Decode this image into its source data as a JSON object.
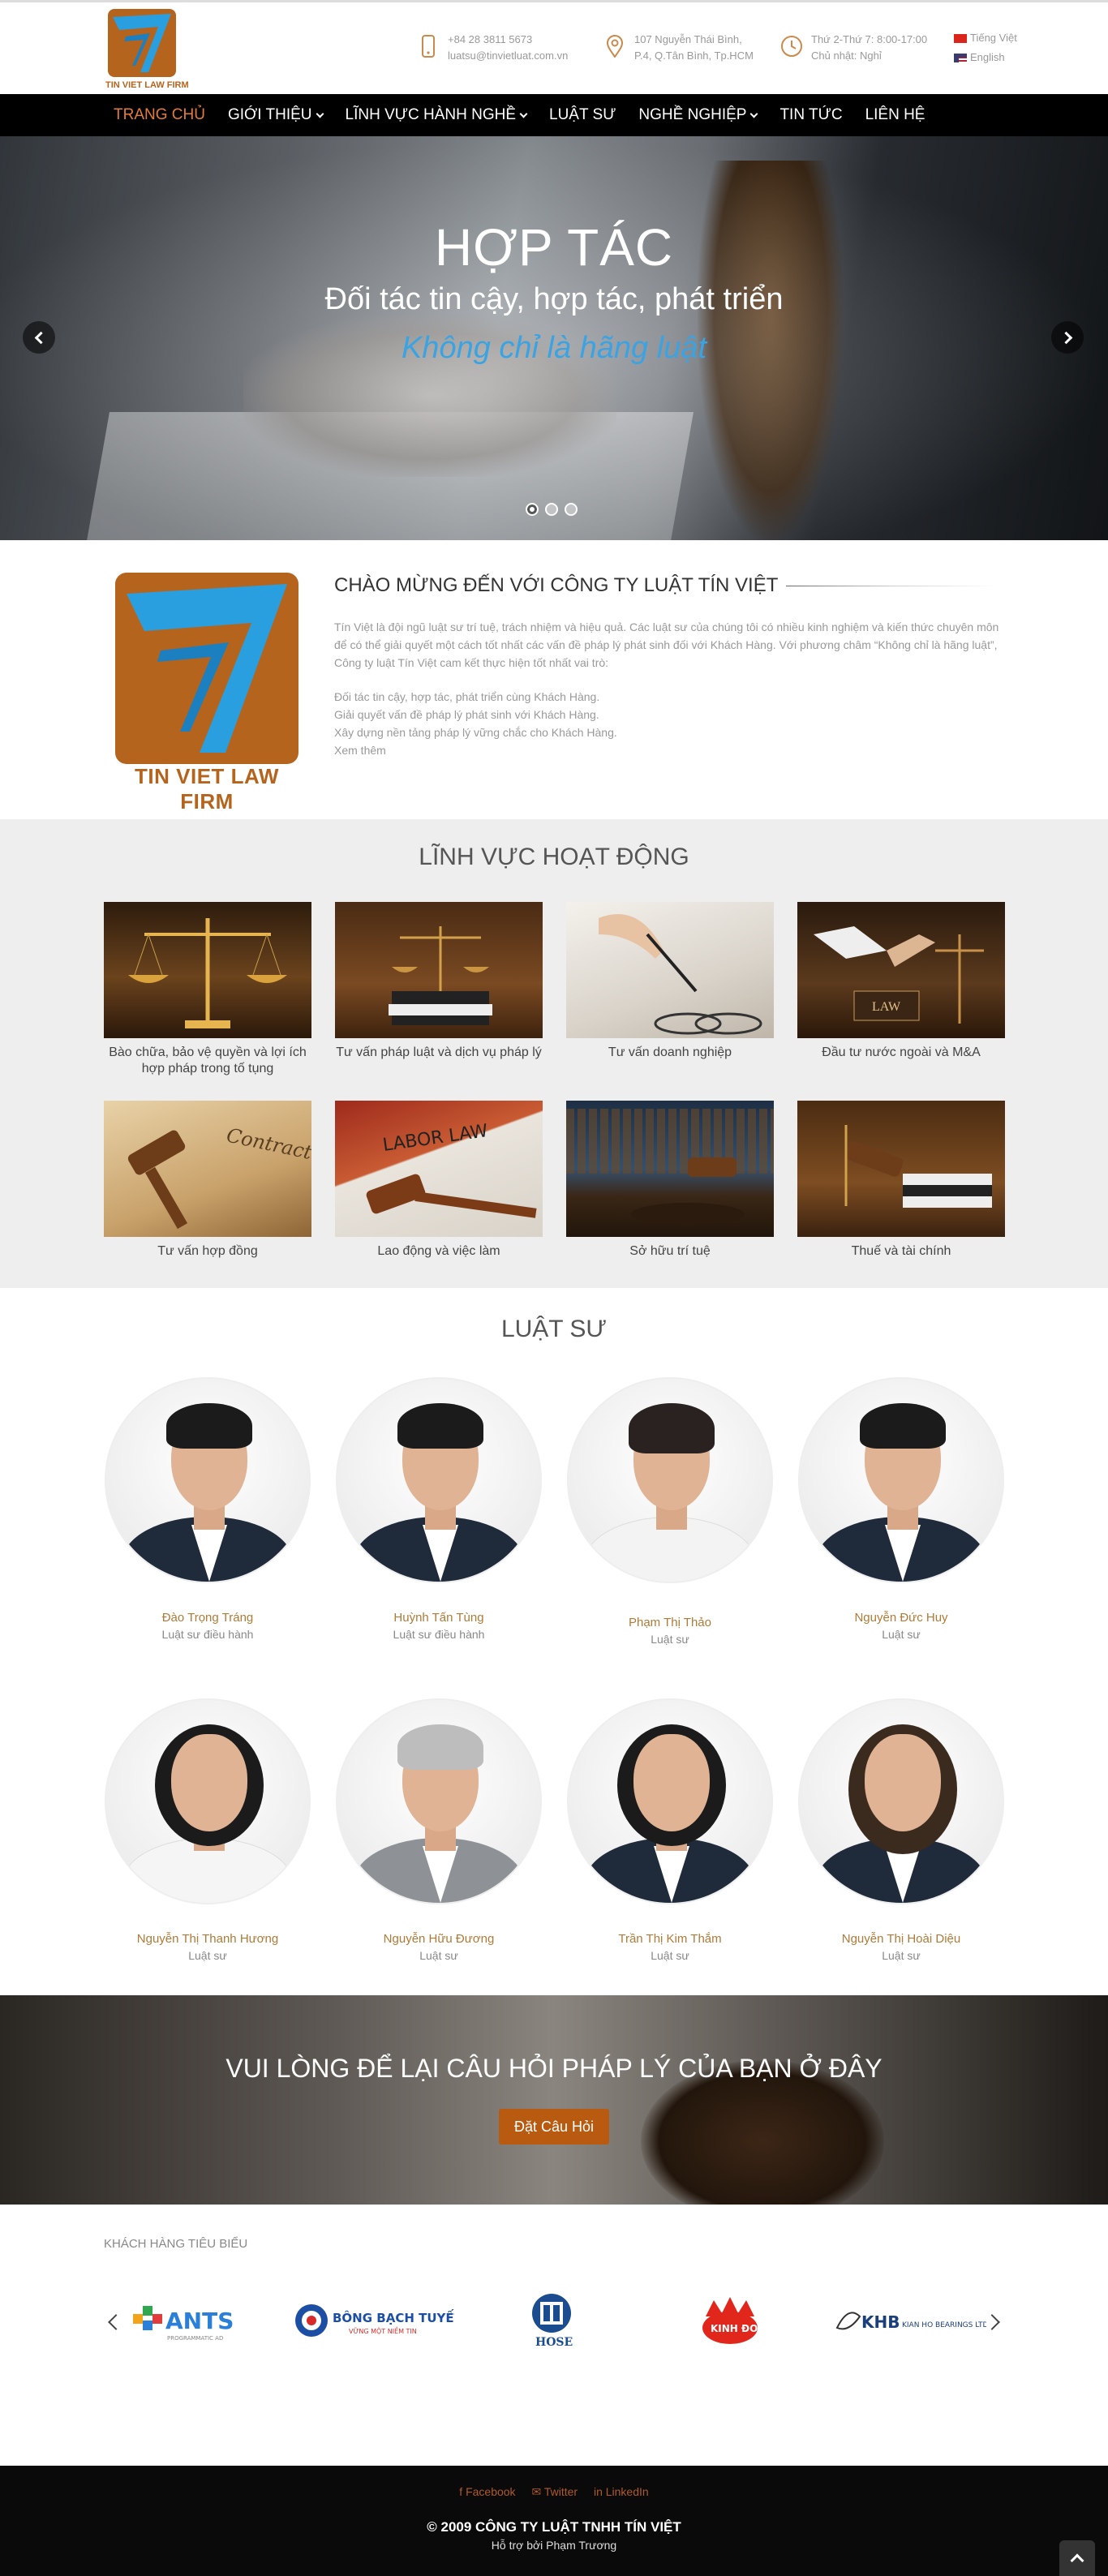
{
  "brand": {
    "logo_caption": "TIN VIET LAW FIRM",
    "color": "#b5641d",
    "accent_blue": "#2a9fe0"
  },
  "header": {
    "phone": "+84 28 3811 5673",
    "email": "luatsu@tinvietluat.com.vn",
    "address_line1": "107 Nguyễn Thái Bình,",
    "address_line2": "P.4, Q.Tân Bình, Tp.HCM",
    "hours_line1": "Thứ 2-Thứ 7: 8:00-17:00",
    "hours_line2": "Chủ nhật: Nghỉ",
    "lang_vi": "Tiếng Việt",
    "lang_en": "English"
  },
  "nav": {
    "items": [
      {
        "label": "TRANG CHỦ"
      },
      {
        "label": "GIỚI THIỆU"
      },
      {
        "label": "LĨNH VỰC HÀNH NGHỀ"
      },
      {
        "label": "LUẬT SƯ"
      },
      {
        "label": "NGHỀ NGHIỆP"
      },
      {
        "label": "TIN TỨC"
      },
      {
        "label": "LIÊN HỆ"
      }
    ],
    "active_color": "#e57b3a"
  },
  "hero": {
    "title": "HỢP TÁC",
    "subtitle": "Đối tác tin cậy, hợp tác, phát triển",
    "tagline": "Không chỉ là hãng luật"
  },
  "welcome": {
    "heading": "CHÀO MỪNG ĐẾN VỚI CÔNG TY LUẬT TÍN VIỆT",
    "paragraph": "Tín Việt là đội ngũ luật sư trí tuệ, trách nhiệm và hiệu quả. Các luật sư của chúng tôi có nhiều kinh nghiệm và kiến thức chuyên môn để có thể giải quyết một cách tốt nhất các vấn đề pháp lý phát sinh đối với Khách Hàng. Với phương châm “Không chỉ là hãng luật”, Công ty luật Tín Việt cam kết thực hiện tốt nhất vai trò:",
    "points": [
      "Đối tác tin cậy, hợp tác, phát triển cùng Khách Hàng.",
      "Giải quyết vấn đề pháp lý phát sinh với Khách Hàng.",
      "Xây dựng nền tảng pháp lý vững chắc cho Khách Hàng."
    ],
    "more": "Xem thêm"
  },
  "fields": {
    "title": "LĨNH VỰC HOẠT ĐỘNG",
    "items": [
      {
        "label": "Bào chữa, bảo vệ quyền và lợi ích hợp pháp trong tố tụng"
      },
      {
        "label": "Tư vấn pháp luật và dịch vụ pháp lý"
      },
      {
        "label": "Tư vấn doanh nghiệp"
      },
      {
        "label": "Đầu tư nước ngoài và M&A"
      },
      {
        "label": "Tư vấn hợp đồng"
      },
      {
        "label": "Lao động và việc làm"
      },
      {
        "label": "Sở hữu trí tuệ"
      },
      {
        "label": "Thuế và tài chính"
      }
    ],
    "image_texts": {
      "contract": "Contract",
      "labor": "LABOR LAW",
      "law": "LAW"
    }
  },
  "lawyers": {
    "title": "LUẬT SƯ",
    "items": [
      {
        "name": "Đào Trọng Tráng",
        "role": "Luật sư điều hành"
      },
      {
        "name": "Huỳnh Tấn Tùng",
        "role": "Luật sư điều hành"
      },
      {
        "name": "Phạm Thị Thảo",
        "role": "Luật sư"
      },
      {
        "name": "Nguyễn Đức Huy",
        "role": "Luật sư"
      },
      {
        "name": "Nguyễn Thị Thanh Hương",
        "role": "Luật sư"
      },
      {
        "name": "Nguyễn Hữu Đương",
        "role": "Luật sư"
      },
      {
        "name": "Trần Thị Kim Thắm",
        "role": "Luật sư"
      },
      {
        "name": "Nguyễn Thị Hoài Diệu",
        "role": "Luật sư"
      }
    ]
  },
  "cta": {
    "heading": "VUI LÒNG ĐỂ LẠI CÂU HỎI PHÁP LÝ CỦA BẠN Ở ĐÂY",
    "button": "Đặt Câu Hỏi"
  },
  "clients": {
    "label": "KHÁCH HÀNG TIÊU BIỂU",
    "logos": [
      {
        "main": "ANTS",
        "sub": "PROGRAMMATIC AD"
      },
      {
        "main": "BÔNG BẠCH TUYẾT",
        "sub": "VỮNG MỘT NIỀM TIN"
      },
      {
        "main": "HOSE"
      },
      {
        "main": "KINH ĐO"
      },
      {
        "main": "KHB",
        "sub": "KIAN HO BEARINGS LTD"
      }
    ]
  },
  "footer": {
    "facebook": "Facebook",
    "twitter": "Twitter",
    "linkedin": "LinkedIn",
    "copyright": "© 2009 CÔNG TY LUẬT TNHH TÍN VIỆT",
    "support": "Hỗ trợ bởi Phạm Trương"
  }
}
